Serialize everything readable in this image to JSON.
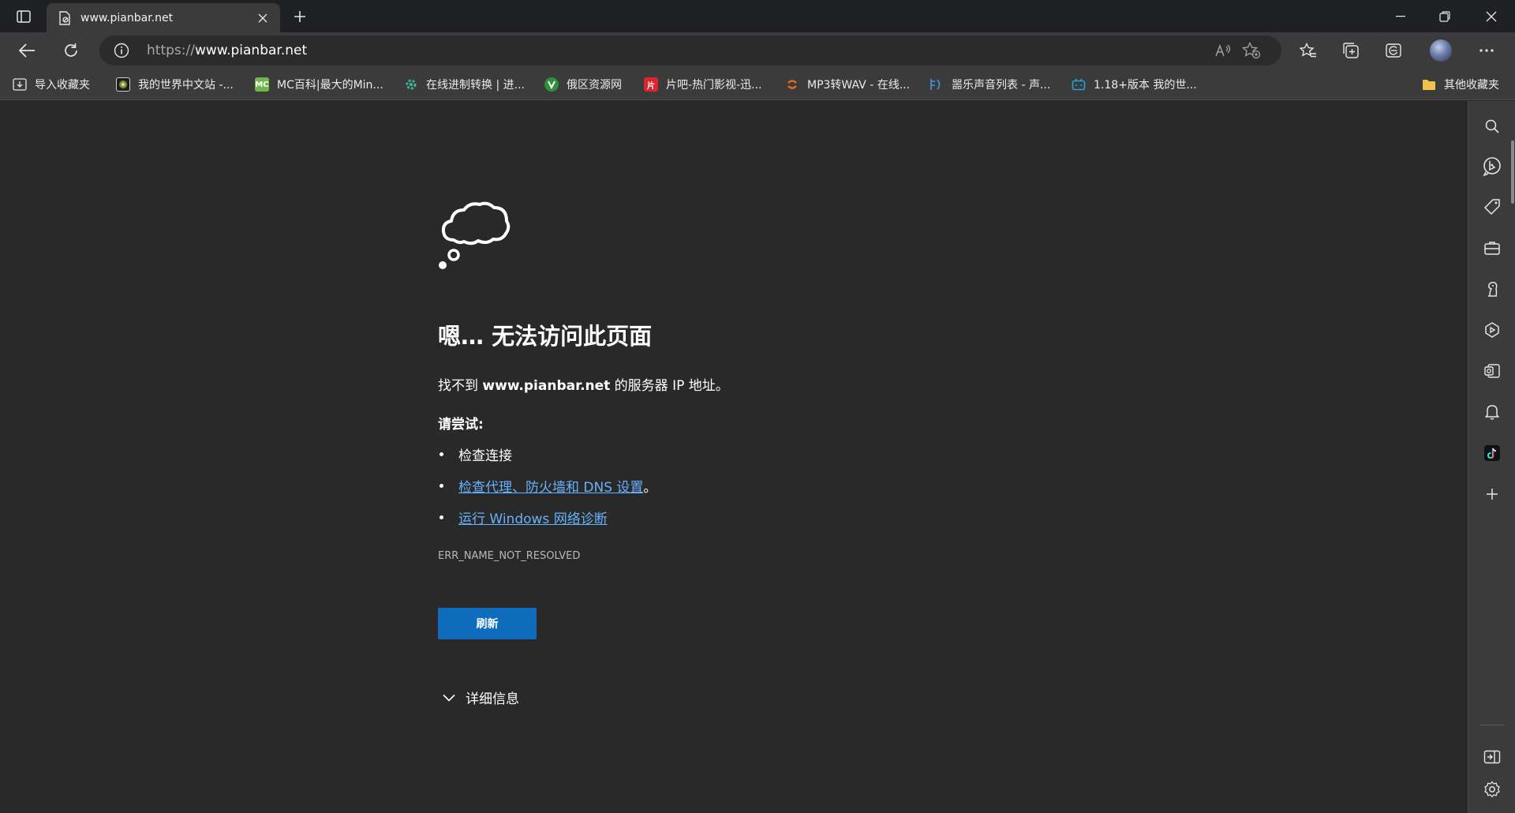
{
  "browser": {
    "tab": {
      "title": "www.pianbar.net"
    },
    "address": {
      "scheme": "https://",
      "host": "www.pianbar.net"
    }
  },
  "favorites": [
    {
      "label": "导入收藏夹",
      "icon": "import-favorites-icon"
    },
    {
      "label": "我的世界中文站 -...",
      "icon": "minecraft-site-favicon"
    },
    {
      "label": "MC百科|最大的Min...",
      "icon": "mcmod-favicon",
      "badge": "MC"
    },
    {
      "label": "在线进制转换 | 进...",
      "icon": "gear-favicon"
    },
    {
      "label": "俄区资源网",
      "icon": "resource-favicon"
    },
    {
      "label": "片吧-热门影视-迅...",
      "icon": "pianba-favicon",
      "badge": "片"
    },
    {
      "label": "MP3转WAV - 在线...",
      "icon": "converter-favicon"
    },
    {
      "label": "噐乐声音列表 - 声...",
      "icon": "sound-list-favicon"
    },
    {
      "label": "1.18+版本 我的世...",
      "icon": "bilibili-favicon"
    }
  ],
  "other_favorites": "其他收藏夹",
  "error_page": {
    "heading": "嗯… 无法访问此页面",
    "desc_prefix": "找不到 ",
    "desc_host": "www.pianbar.net",
    "desc_suffix": " 的服务器 IP 地址。",
    "try_label": "请尝试:",
    "suggestions": {
      "check_connection": "检查连接",
      "check_proxy": "检查代理、防火墙和 DNS 设置",
      "check_proxy_suffix": "。",
      "run_diagnostics": "运行 Windows 网络诊断"
    },
    "error_code": "ERR_NAME_NOT_RESOLVED",
    "refresh_label": "刷新",
    "details_label": "详细信息"
  },
  "colors": {
    "accent": "#0f6cbd",
    "link": "#66b2ff",
    "page_bg": "#292929",
    "chrome_bg": "#3b3b3b"
  }
}
